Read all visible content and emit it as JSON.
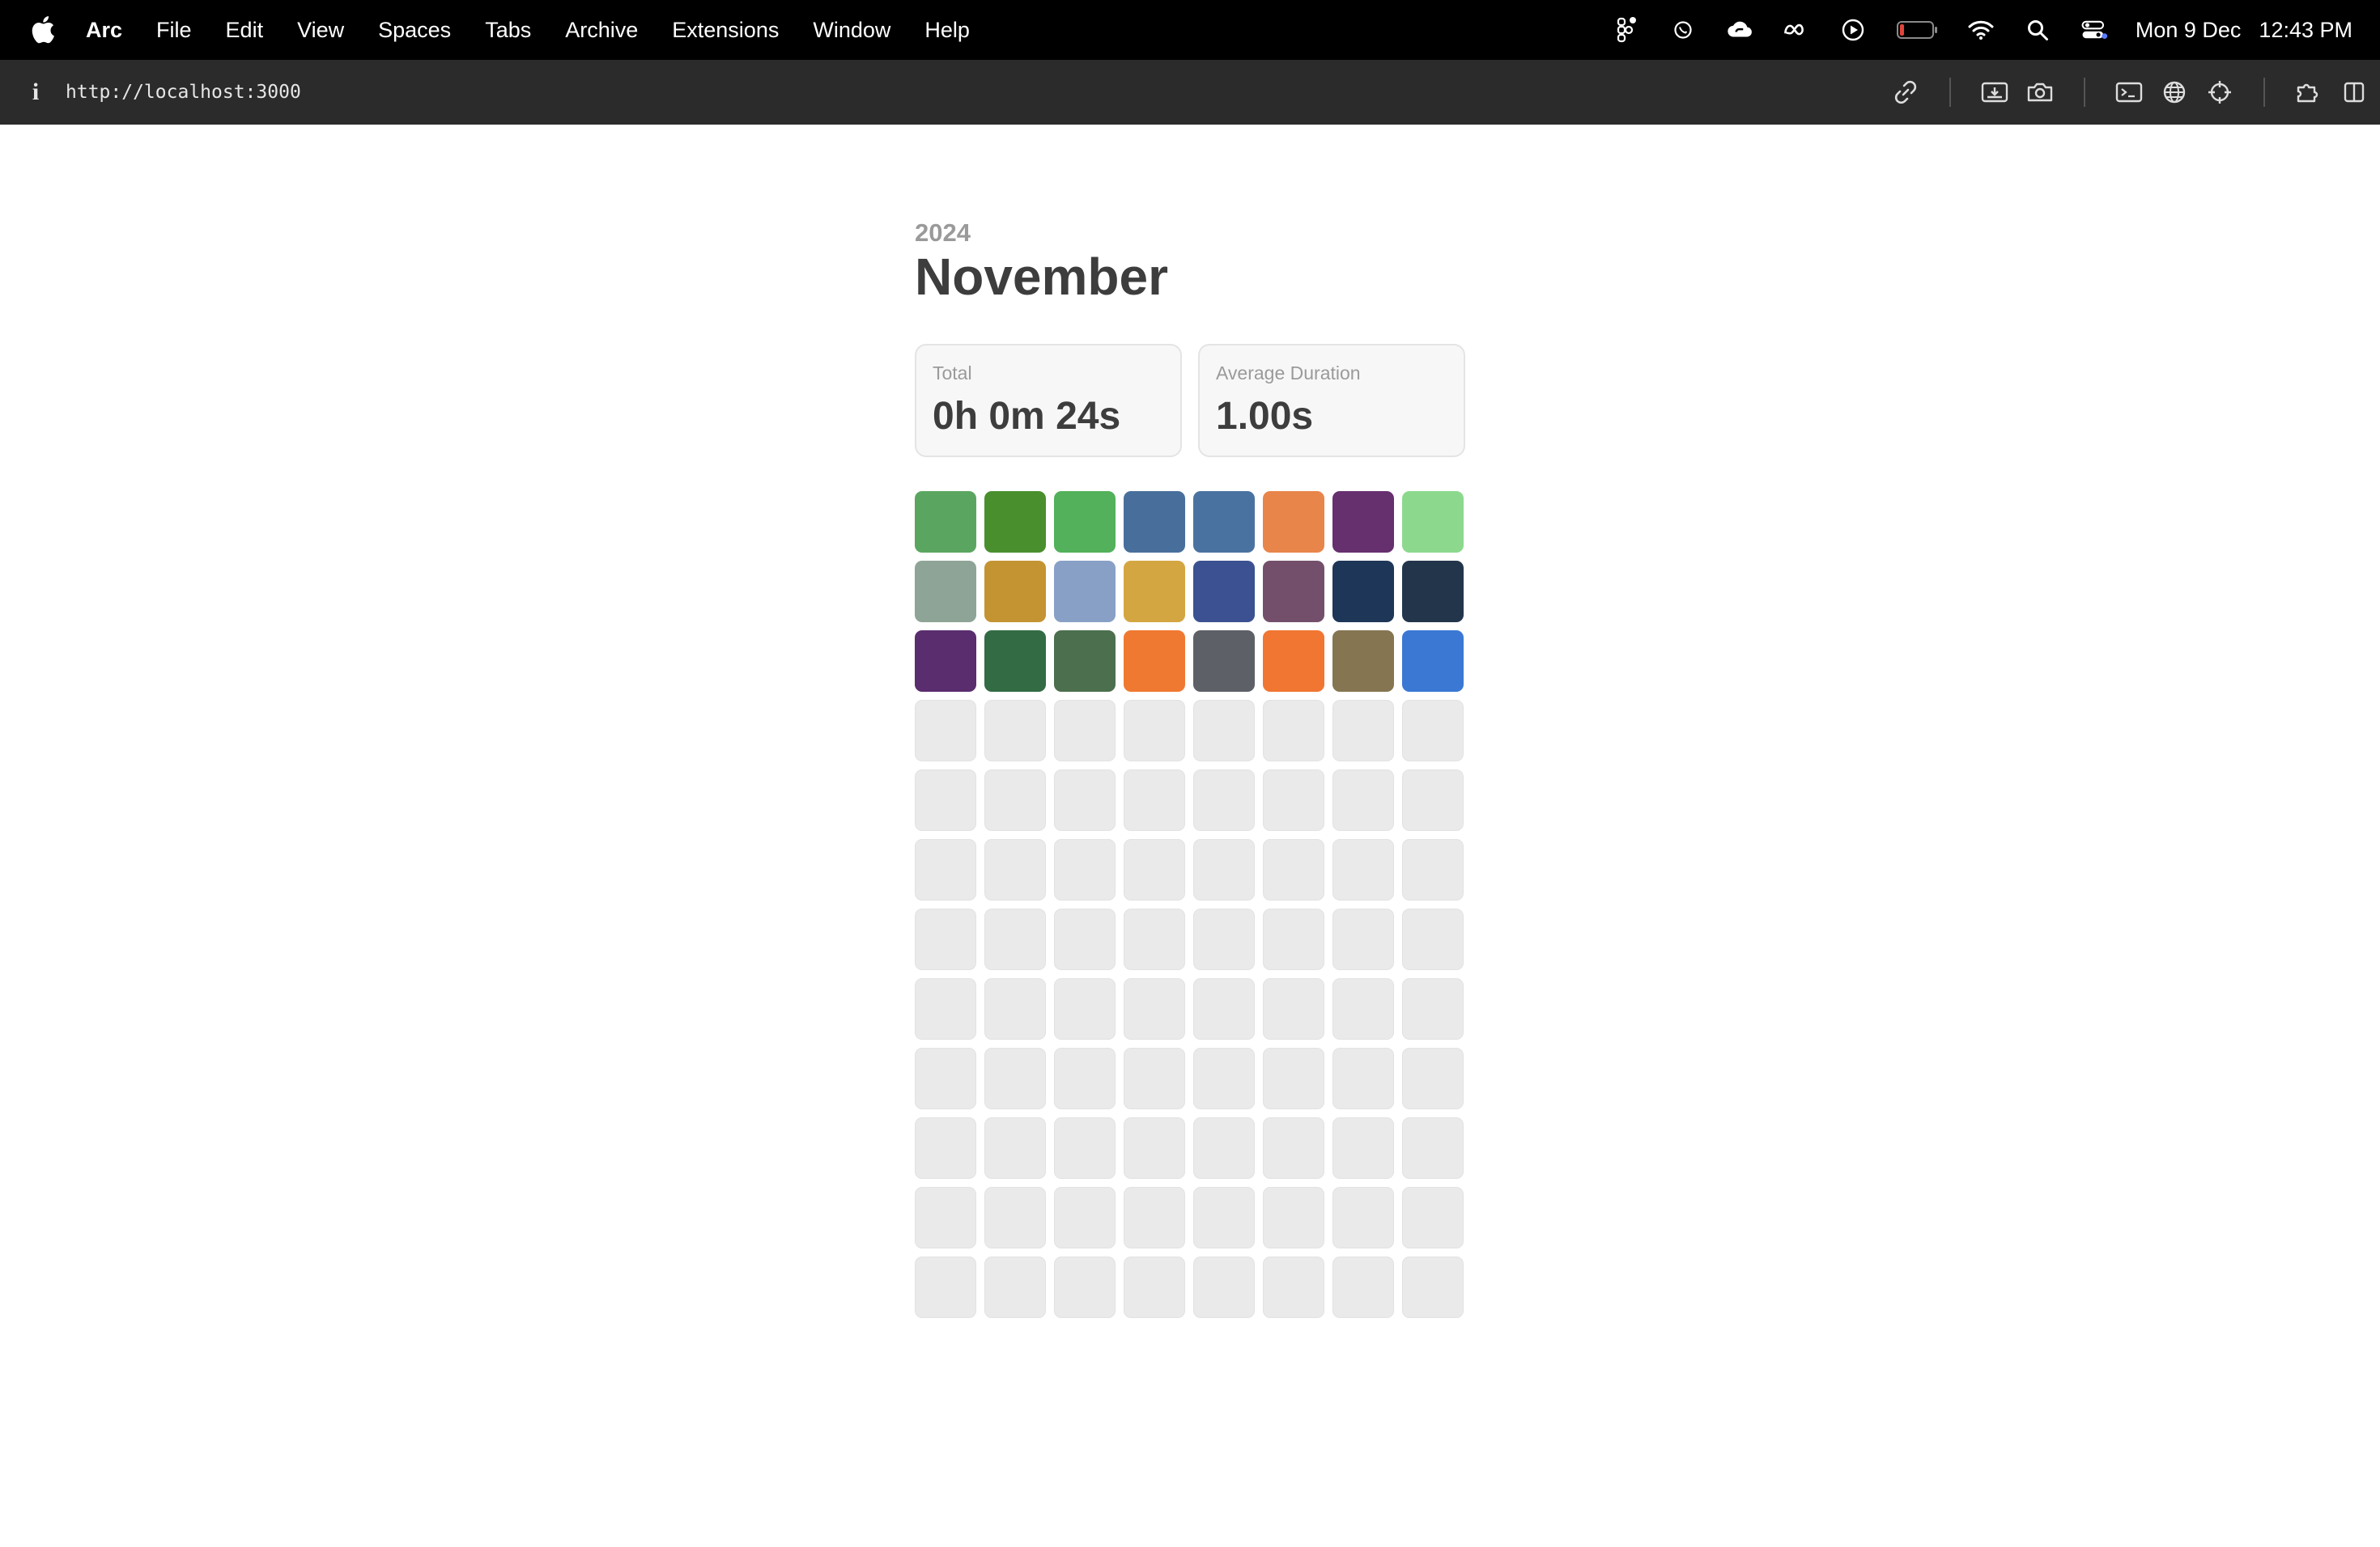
{
  "menubar": {
    "app_name": "Arc",
    "items": [
      "File",
      "Edit",
      "View",
      "Spaces",
      "Tabs",
      "Archive",
      "Extensions",
      "Window",
      "Help"
    ],
    "status_icons": [
      "figma-icon",
      "whatsapp-icon",
      "creative-cloud-icon",
      "meta-icon",
      "play-icon",
      "battery-icon",
      "wifi-icon",
      "search-icon",
      "control-center-icon"
    ],
    "date": "Mon 9 Dec",
    "time": "12:43 PM"
  },
  "toolbar": {
    "info_label": "i",
    "url": "http://localhost:3000",
    "icons": [
      "link-icon",
      "capture-icon",
      "camera-icon",
      "terminal-icon",
      "globe-icon",
      "crosshair-icon",
      "extensions-icon",
      "sidebar-icon"
    ]
  },
  "page": {
    "year": "2024",
    "month": "November",
    "stats": [
      {
        "label": "Total",
        "value": "0h 0m 24s"
      },
      {
        "label": "Average Duration",
        "value": "1.00s"
      }
    ]
  },
  "grid": {
    "columns": 8,
    "empty_color": "#eaeaea",
    "filled_colors": [
      "#5aa660",
      "#4a8f2e",
      "#52b15a",
      "#486f9c",
      "#4a72a0",
      "#e8854a",
      "#662f6e",
      "#8cd98e",
      "#8ea496",
      "#c49432",
      "#88a0c6",
      "#d4a642",
      "#3b5191",
      "#744f6b",
      "#1e3657",
      "#23354b",
      "#5a2d6e",
      "#336b44",
      "#4c6f4e",
      "#f07932",
      "#5d6066",
      "#f07632",
      "#857551",
      "#3a78d4"
    ],
    "empty_count": 72
  }
}
